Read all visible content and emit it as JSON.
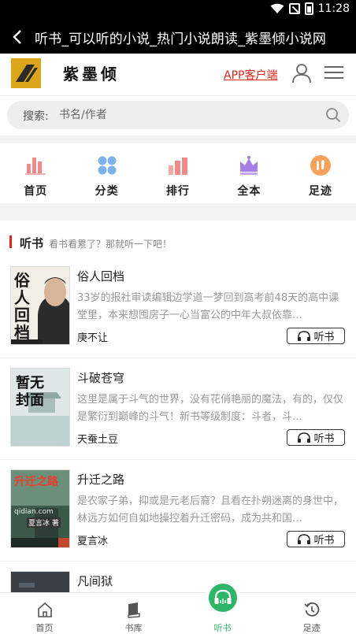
{
  "status_bar": {
    "time": "11:28"
  },
  "title_bar": {
    "title": "听书_可以听的小说_热门小说朗读_紫墨倾小说网"
  },
  "header": {
    "logo_text": "紫墨倾",
    "app_link": "APP客户端"
  },
  "search": {
    "label": "搜索:",
    "placeholder": "书名/作者"
  },
  "nav": [
    {
      "label": "首页",
      "icon": "bar-chart-icon",
      "color": "#f08a8a"
    },
    {
      "label": "分类",
      "icon": "grid-dots-icon",
      "color": "#7fb1ef"
    },
    {
      "label": "排行",
      "icon": "ranking-icon",
      "color": "#f08a8a"
    },
    {
      "label": "全本",
      "icon": "crown-icon",
      "color": "#a77ee6"
    },
    {
      "label": "足迹",
      "icon": "footprint-icon",
      "color": "#f6a25a"
    }
  ],
  "section": {
    "title": "听书",
    "subtitle": "看书看累了？那就听一下吧！"
  },
  "books": [
    {
      "title": "俗人回档",
      "desc": "33岁的报社审读编辑边学道一梦回到高考前48天的高中课堂里，本来想囤房子一心当富公的中年大叔依靠…",
      "author": "庚不让",
      "button": "听书",
      "cover_text": "俗人回档"
    },
    {
      "title": "斗破苍穹",
      "desc": "这里是属于斗气的世界，没有花俏艳丽的魔法，有的，仅仅是繁衍到巅峰的斗气！新书等级制度：斗者，斗…",
      "author": "天蚕土豆",
      "button": "听书",
      "cover_text": "暂无封面"
    },
    {
      "title": "升迁之路",
      "desc": "是农家子弟，抑或是元老后裔？且看在扑朔迷离的身世中，林远方如何自如地操控着升迁密码，成为共和国…",
      "author": "夏言冰",
      "button": "听书",
      "cover_text": "升迁之路",
      "cover_sub": "夏言冰 著",
      "cover_site": "qidian.com"
    },
    {
      "title": "凡间狱",
      "desc": "",
      "author": "",
      "button": "",
      "cover_text": ""
    }
  ],
  "tabbar": [
    {
      "label": "首页",
      "icon": "home-icon"
    },
    {
      "label": "书库",
      "icon": "book-icon"
    },
    {
      "label": "听书",
      "icon": "headphones-icon",
      "active": true
    },
    {
      "label": "足迹",
      "icon": "history-icon"
    }
  ],
  "colors": {
    "accent": "#e0251c",
    "green": "#2fb56a",
    "logo": "#d8a51b"
  }
}
